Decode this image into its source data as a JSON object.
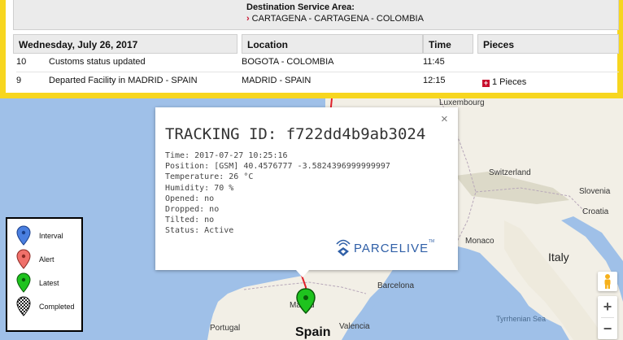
{
  "destination": {
    "title": "Destination Service Area:",
    "value": "CARTAGENA - CARTAGENA - COLOMBIA"
  },
  "table": {
    "headers": [
      "Wednesday, July 26, 2017",
      "Location",
      "Time",
      "Pieces"
    ],
    "rows": [
      {
        "num": "10",
        "desc": "Customs status updated",
        "location": "BOGOTA - COLOMBIA",
        "time": "11:45",
        "pieces": ""
      },
      {
        "num": "9",
        "desc": "Departed Facility in MADRID - SPAIN",
        "location": "MADRID - SPAIN",
        "time": "12:15",
        "pieces": "1 Pieces"
      }
    ]
  },
  "info_window": {
    "title": "TRACKING ID: f722dd4b9ab3024",
    "lines": [
      "Time: 2017-07-27 10:25:16",
      "Position: [GSM] 40.4576777 -3.5824396999999997",
      "Temperature: 26 °C",
      "Humidity: 70 %",
      "Opened: no",
      "Dropped: no",
      "Tilted: no",
      "Status: Active"
    ],
    "close": "×",
    "logo_text": "PARCELIVE",
    "logo_tm": "TM"
  },
  "legend": [
    {
      "label": "Interval",
      "color": "#4a7fe0",
      "icon": "blue-pin-icon"
    },
    {
      "label": "Alert",
      "color": "#f0706a",
      "icon": "red-pin-icon"
    },
    {
      "label": "Latest",
      "color": "#1ec31e",
      "icon": "green-pin-icon"
    },
    {
      "label": "Completed",
      "color": "#222222",
      "icon": "checkered-pin-icon"
    }
  ],
  "map_labels": {
    "luxembourg": "Luxembourg",
    "switzerland": "Switzerland",
    "slovenia": "Slovenia",
    "croatia": "Croatia",
    "monaco": "Monaco",
    "italy": "Italy",
    "spain": "Spain",
    "madrid": "Madrid",
    "barcelona": "Barcelona",
    "valencia": "Valencia",
    "portugal": "Portugal",
    "tyrrhenian": "Tyrrhenian Sea"
  },
  "controls": {
    "zoom_in": "+",
    "zoom_out": "−"
  },
  "colors": {
    "panel_border": "#f7d61f",
    "accent_red": "#c8102e",
    "route": "#e0202a"
  }
}
